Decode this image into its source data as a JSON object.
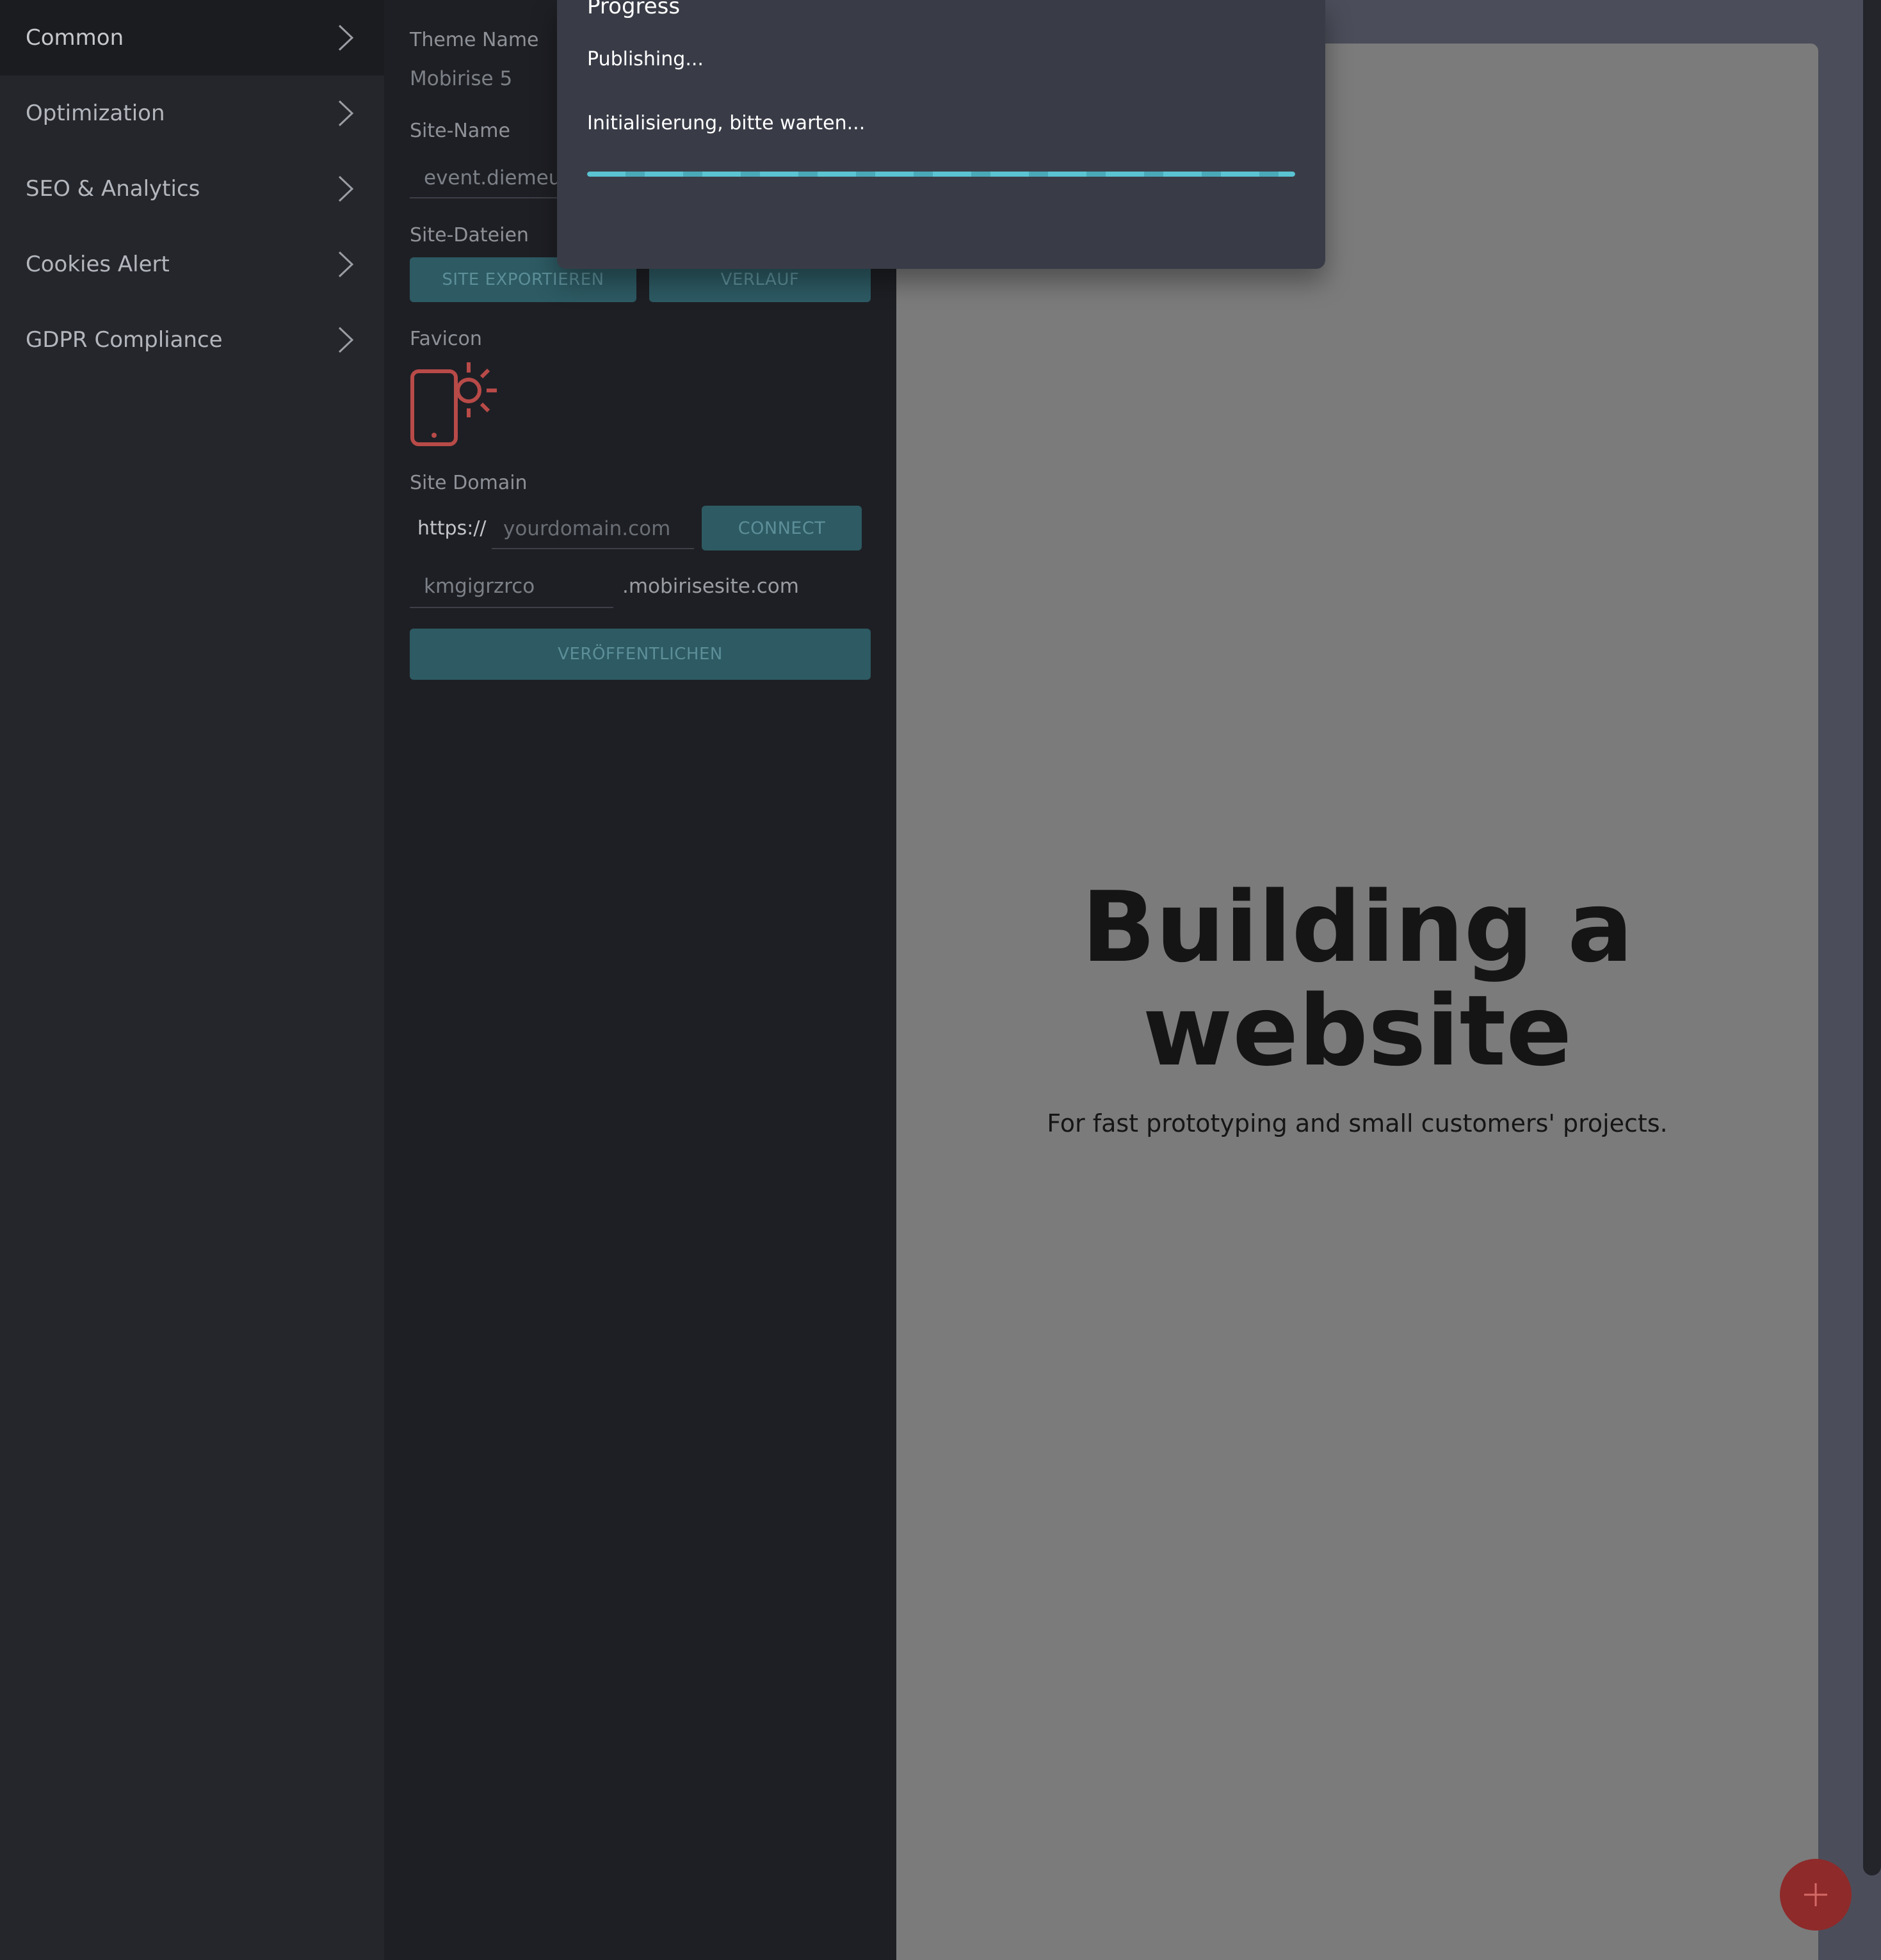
{
  "sidebar": {
    "items": [
      {
        "label": "Common"
      },
      {
        "label": "Optimization"
      },
      {
        "label": "SEO & Analytics"
      },
      {
        "label": "Cookies Alert"
      },
      {
        "label": "GDPR Compliance"
      }
    ]
  },
  "settings": {
    "theme_name_label": "Theme Name",
    "theme_name_value": "Mobirise 5",
    "site_name_label": "Site-Name",
    "site_name_value": "event.diemeute",
    "site_files_label": "Site-Dateien",
    "export_button": "SITE EXPORTIEREN",
    "history_button": "VERLAUF",
    "favicon_label": "Favicon",
    "domain_label": "Site Domain",
    "domain_prefix": "https://",
    "domain_placeholder": "yourdomain.com",
    "connect_button": "CONNECT",
    "subdomain_value": "kmgigrzrco",
    "subdomain_suffix": ".mobirisesite.com",
    "publish_button": "VERÖFFENTLICHEN"
  },
  "modal": {
    "title": "Progress",
    "status": "Publishing...",
    "message": "Initialisierung, bitte warten...",
    "progress": 1.0
  },
  "preview": {
    "title_line1": "Building a",
    "title_line2": "website",
    "subtitle": "For fast prototyping and small customers' projects."
  },
  "colors": {
    "accent_teal": "#2d5a63",
    "progress_bar": "#5bc3d2",
    "favicon_red": "#b84a48",
    "fab_red": "#8e2a2a"
  },
  "icons": {
    "chevron": "chevron-right-icon",
    "favicon": "phone-sun-icon",
    "fab": "plus-icon"
  }
}
